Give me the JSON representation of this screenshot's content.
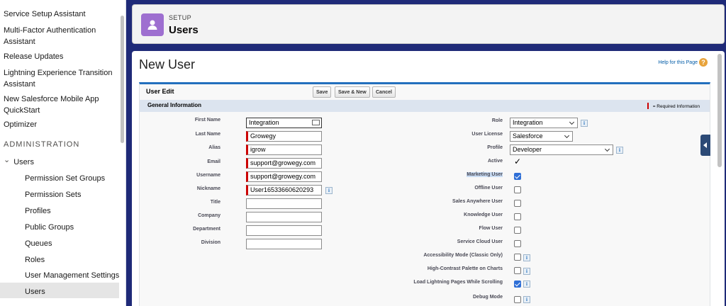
{
  "sidebar": {
    "items": [
      {
        "label": "Service Setup Assistant"
      },
      {
        "label": "Multi-Factor Authentication Assistant"
      },
      {
        "label": "Release Updates"
      },
      {
        "label": "Lightning Experience Transition Assistant"
      },
      {
        "label": "New Salesforce Mobile App QuickStart"
      },
      {
        "label": "Optimizer"
      }
    ],
    "section": "ADMINISTRATION",
    "users_group": {
      "chevron": "⌄",
      "label": "Users"
    },
    "sub_items": [
      {
        "label": "Permission Set Groups"
      },
      {
        "label": "Permission Sets"
      },
      {
        "label": "Profiles"
      },
      {
        "label": "Public Groups"
      },
      {
        "label": "Queues"
      },
      {
        "label": "Roles"
      },
      {
        "label": "User Management Settings"
      },
      {
        "label": "Users"
      }
    ],
    "active_item": "Users"
  },
  "header": {
    "eyebrow": "SETUP",
    "title": "Users",
    "icon": "user-icon"
  },
  "page": {
    "title": "New User",
    "help_link": "Help for this Page",
    "help_icon": "?"
  },
  "form": {
    "title": "User Edit",
    "buttons": {
      "save": "Save",
      "save_new": "Save & New",
      "cancel": "Cancel"
    },
    "section_title": "General Information",
    "required_legend": "= Required Information",
    "info_glyph": "i",
    "left_fields": [
      {
        "label": "First Name",
        "value": "Integration",
        "required": false
      },
      {
        "label": "Last Name",
        "value": "Growegy",
        "required": true
      },
      {
        "label": "Alias",
        "value": "igrow",
        "required": true
      },
      {
        "label": "Email",
        "value": "support@growegy.com",
        "required": true
      },
      {
        "label": "Username",
        "value": "support@growegy.com",
        "required": true
      },
      {
        "label": "Nickname",
        "value": "User16533660620293",
        "required": true
      },
      {
        "label": "Title",
        "value": ""
      },
      {
        "label": "Company",
        "value": ""
      },
      {
        "label": "Department",
        "value": ""
      },
      {
        "label": "Division",
        "value": ""
      }
    ],
    "right_selects": [
      {
        "label": "Role",
        "value": "Integration"
      },
      {
        "label": "User License",
        "value": "Salesforce"
      },
      {
        "label": "Profile",
        "value": "Developer"
      }
    ],
    "active": {
      "label": "Active",
      "value": "✓"
    },
    "checkboxes": [
      {
        "label": "Marketing User",
        "checked": true
      },
      {
        "label": "Offline User",
        "checked": false
      },
      {
        "label": "Sales Anywhere User",
        "checked": false
      },
      {
        "label": "Knowledge User",
        "checked": false
      },
      {
        "label": "Flow User",
        "checked": false
      },
      {
        "label": "Service Cloud User",
        "checked": false
      },
      {
        "label": "Accessibility Mode (Classic Only)",
        "checked": false
      },
      {
        "label": "High-Contrast Palette on Charts",
        "checked": false
      },
      {
        "label": "Load Lightning Pages While Scrolling",
        "checked": true
      },
      {
        "label": "Debug Mode",
        "checked": false
      }
    ]
  },
  "colors": {
    "nav_bg": "#1f2a78",
    "header_icon": "#9e6fd0",
    "required": "#cc0000",
    "checkbox": "#2f6fd6"
  }
}
